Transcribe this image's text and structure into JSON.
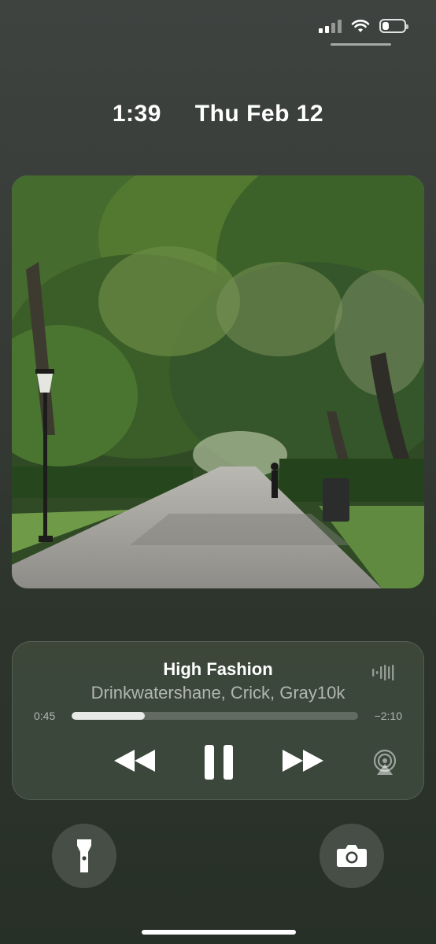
{
  "status_bar": {
    "signal_icon": "cellular-signal-icon",
    "wifi_icon": "wifi-icon",
    "battery_icon": "battery-icon",
    "battery_level": 0.3
  },
  "lock_screen": {
    "time": "1:39",
    "date": "Thu Feb 12"
  },
  "widget": {
    "type": "photo",
    "icon": "photo-park-image"
  },
  "now_playing": {
    "title": "High Fashion",
    "artist": "Drinkwatershane, Crick, Gray10k",
    "elapsed": "0:45",
    "remaining": "−2:10",
    "progress": 0.255,
    "controls": [
      "rewind-icon",
      "pause-icon",
      "fast-forward-icon",
      "airplay-icon",
      "waveform-icon"
    ]
  },
  "shortcuts": {
    "left": "flashlight-icon",
    "right": "camera-icon"
  },
  "colors": {
    "background": "#353a35",
    "accent": "#ffffff"
  }
}
